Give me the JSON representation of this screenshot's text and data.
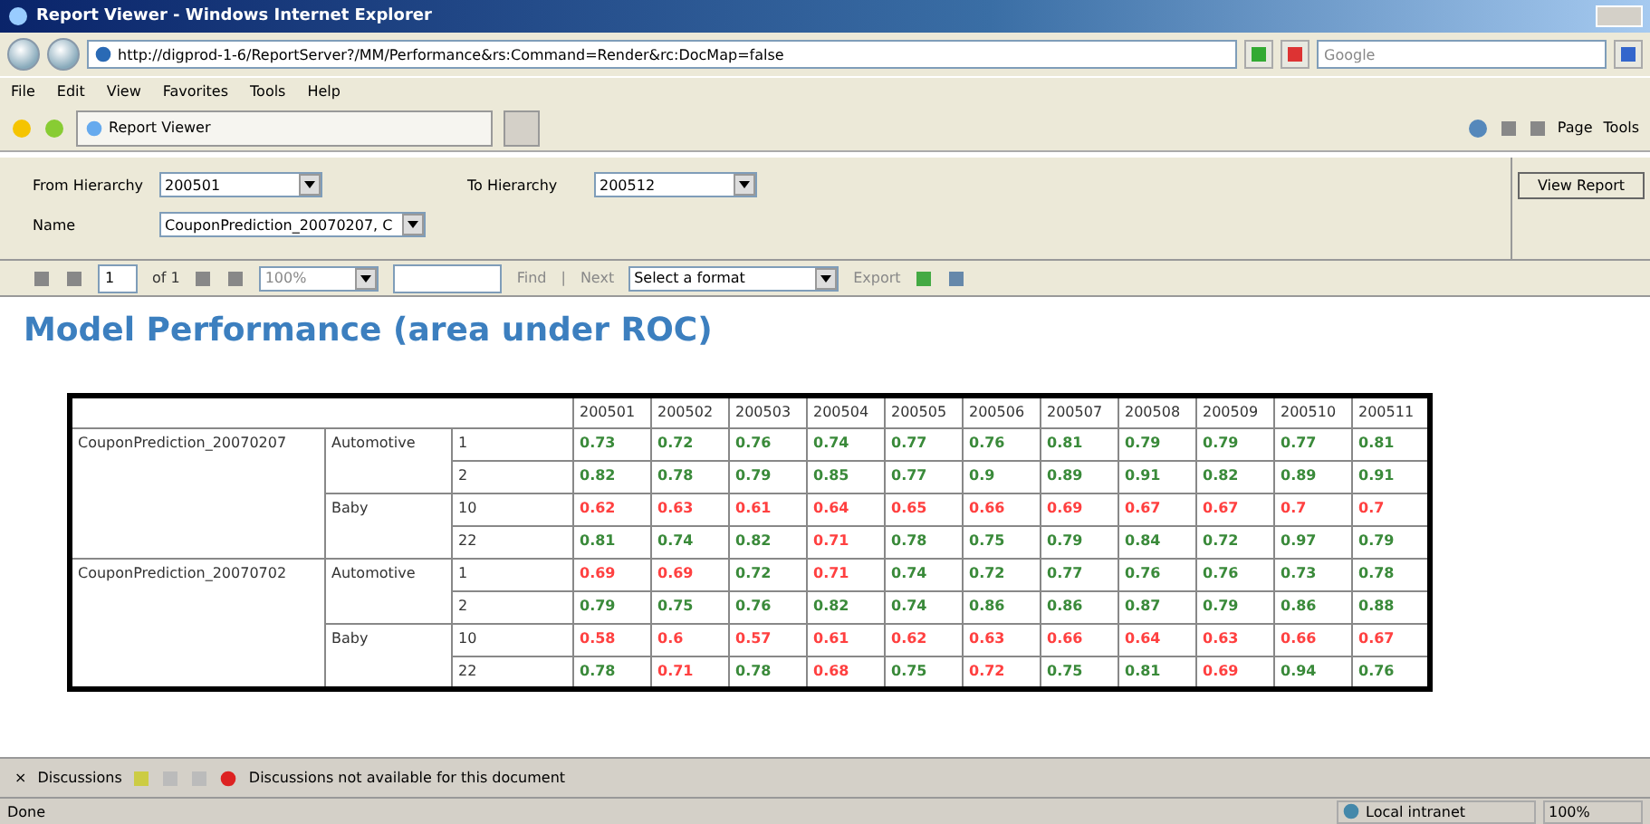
{
  "window": {
    "title": "Report Viewer - Windows Internet Explorer"
  },
  "address_bar": {
    "url": "http://digprod-1-6/ReportServer?/MM/Performance&rs:Command=Render&rc:DocMap=false",
    "search_placeholder": "Google"
  },
  "menu": [
    "File",
    "Edit",
    "View",
    "Favorites",
    "Tools",
    "Help"
  ],
  "tab": {
    "label": "Report Viewer"
  },
  "command_bar": [
    "Page",
    "Tools"
  ],
  "parameters": [
    {
      "label": "From Hierarchy",
      "value": "200501"
    },
    {
      "label": "To Hierarchy",
      "value": "200512"
    },
    {
      "label": "Name",
      "value": "CouponPrediction_20070207, C"
    }
  ],
  "view_report": "View Report",
  "report_toolbar": {
    "page": "1",
    "of": "of 1",
    "zoom": "100%",
    "find": "Find",
    "separator": "|",
    "next": "Next",
    "format": "Select a format",
    "export": "Export"
  },
  "report_title": "Model Performance (area under ROC)",
  "table": {
    "columns": [
      "200501",
      "200502",
      "200503",
      "200504",
      "200505",
      "200506",
      "200507",
      "200508",
      "200509",
      "200510",
      "200511"
    ],
    "groups": [
      {
        "name": "CouponPrediction_20070207",
        "categories": [
          {
            "name": "Automotive",
            "segments": [
              {
                "label": "1",
                "values": [
                  {
                    "text": "0.73",
                    "color": "#3a8a3a"
                  },
                  {
                    "text": "0.72",
                    "color": "#3a8a3a"
                  },
                  {
                    "text": "0.76",
                    "color": "#3a8a3a"
                  },
                  {
                    "text": "0.74",
                    "color": "#3a8a3a"
                  },
                  {
                    "text": "0.77",
                    "color": "#3a8a3a"
                  },
                  {
                    "text": "0.76",
                    "color": "#3a8a3a"
                  },
                  {
                    "text": "0.81",
                    "color": "#3a8a3a"
                  },
                  {
                    "text": "0.79",
                    "color": "#3a8a3a"
                  },
                  {
                    "text": "0.79",
                    "color": "#3a8a3a"
                  },
                  {
                    "text": "0.77",
                    "color": "#3a8a3a"
                  },
                  {
                    "text": "0.81",
                    "color": "#3a8a3a"
                  }
                ]
              },
              {
                "label": "2",
                "values": [
                  {
                    "text": "0.82",
                    "color": "#3a8a3a"
                  },
                  {
                    "text": "0.78",
                    "color": "#3a8a3a"
                  },
                  {
                    "text": "0.79",
                    "color": "#3a8a3a"
                  },
                  {
                    "text": "0.85",
                    "color": "#3a8a3a"
                  },
                  {
                    "text": "0.77",
                    "color": "#3a8a3a"
                  },
                  {
                    "text": "0.9",
                    "color": "#3a8a3a"
                  },
                  {
                    "text": "0.89",
                    "color": "#3a8a3a"
                  },
                  {
                    "text": "0.91",
                    "color": "#3a8a3a"
                  },
                  {
                    "text": "0.82",
                    "color": "#3a8a3a"
                  },
                  {
                    "text": "0.89",
                    "color": "#3a8a3a"
                  },
                  {
                    "text": "0.91",
                    "color": "#3a8a3a"
                  }
                ]
              }
            ]
          },
          {
            "name": "Baby",
            "segments": [
              {
                "label": "10",
                "values": [
                  {
                    "text": "0.62",
                    "color": "#ff4040"
                  },
                  {
                    "text": "0.63",
                    "color": "#ff4040"
                  },
                  {
                    "text": "0.61",
                    "color": "#ff4040"
                  },
                  {
                    "text": "0.64",
                    "color": "#ff4040"
                  },
                  {
                    "text": "0.65",
                    "color": "#ff4040"
                  },
                  {
                    "text": "0.66",
                    "color": "#ff4040"
                  },
                  {
                    "text": "0.69",
                    "color": "#ff4040"
                  },
                  {
                    "text": "0.67",
                    "color": "#ff4040"
                  },
                  {
                    "text": "0.67",
                    "color": "#ff4040"
                  },
                  {
                    "text": "0.7",
                    "color": "#ff4040"
                  },
                  {
                    "text": "0.7",
                    "color": "#ff4040"
                  }
                ]
              },
              {
                "label": "22",
                "values": [
                  {
                    "text": "0.81",
                    "color": "#3a8a3a"
                  },
                  {
                    "text": "0.74",
                    "color": "#3a8a3a"
                  },
                  {
                    "text": "0.82",
                    "color": "#3a8a3a"
                  },
                  {
                    "text": "0.71",
                    "color": "#ff4040"
                  },
                  {
                    "text": "0.78",
                    "color": "#3a8a3a"
                  },
                  {
                    "text": "0.75",
                    "color": "#3a8a3a"
                  },
                  {
                    "text": "0.79",
                    "color": "#3a8a3a"
                  },
                  {
                    "text": "0.84",
                    "color": "#3a8a3a"
                  },
                  {
                    "text": "0.72",
                    "color": "#3a8a3a"
                  },
                  {
                    "text": "0.97",
                    "color": "#3a8a3a"
                  },
                  {
                    "text": "0.79",
                    "color": "#3a8a3a"
                  }
                ]
              }
            ]
          }
        ]
      },
      {
        "name": "CouponPrediction_20070702",
        "categories": [
          {
            "name": "Automotive",
            "segments": [
              {
                "label": "1",
                "values": [
                  {
                    "text": "0.69",
                    "color": "#ff4040"
                  },
                  {
                    "text": "0.69",
                    "color": "#ff4040"
                  },
                  {
                    "text": "0.72",
                    "color": "#3a8a3a"
                  },
                  {
                    "text": "0.71",
                    "color": "#ff4040"
                  },
                  {
                    "text": "0.74",
                    "color": "#3a8a3a"
                  },
                  {
                    "text": "0.72",
                    "color": "#3a8a3a"
                  },
                  {
                    "text": "0.77",
                    "color": "#3a8a3a"
                  },
                  {
                    "text": "0.76",
                    "color": "#3a8a3a"
                  },
                  {
                    "text": "0.76",
                    "color": "#3a8a3a"
                  },
                  {
                    "text": "0.73",
                    "color": "#3a8a3a"
                  },
                  {
                    "text": "0.78",
                    "color": "#3a8a3a"
                  }
                ]
              },
              {
                "label": "2",
                "values": [
                  {
                    "text": "0.79",
                    "color": "#3a8a3a"
                  },
                  {
                    "text": "0.75",
                    "color": "#3a8a3a"
                  },
                  {
                    "text": "0.76",
                    "color": "#3a8a3a"
                  },
                  {
                    "text": "0.82",
                    "color": "#3a8a3a"
                  },
                  {
                    "text": "0.74",
                    "color": "#3a8a3a"
                  },
                  {
                    "text": "0.86",
                    "color": "#3a8a3a"
                  },
                  {
                    "text": "0.86",
                    "color": "#3a8a3a"
                  },
                  {
                    "text": "0.87",
                    "color": "#3a8a3a"
                  },
                  {
                    "text": "0.79",
                    "color": "#3a8a3a"
                  },
                  {
                    "text": "0.86",
                    "color": "#3a8a3a"
                  },
                  {
                    "text": "0.88",
                    "color": "#3a8a3a"
                  }
                ]
              }
            ]
          },
          {
            "name": "Baby",
            "segments": [
              {
                "label": "10",
                "values": [
                  {
                    "text": "0.58",
                    "color": "#ff4040"
                  },
                  {
                    "text": "0.6",
                    "color": "#ff4040"
                  },
                  {
                    "text": "0.57",
                    "color": "#ff4040"
                  },
                  {
                    "text": "0.61",
                    "color": "#ff4040"
                  },
                  {
                    "text": "0.62",
                    "color": "#ff4040"
                  },
                  {
                    "text": "0.63",
                    "color": "#ff4040"
                  },
                  {
                    "text": "0.66",
                    "color": "#ff4040"
                  },
                  {
                    "text": "0.64",
                    "color": "#ff4040"
                  },
                  {
                    "text": "0.63",
                    "color": "#ff4040"
                  },
                  {
                    "text": "0.66",
                    "color": "#ff4040"
                  },
                  {
                    "text": "0.67",
                    "color": "#ff4040"
                  }
                ]
              },
              {
                "label": "22",
                "values": [
                  {
                    "text": "0.78",
                    "color": "#3a8a3a"
                  },
                  {
                    "text": "0.71",
                    "color": "#ff4040"
                  },
                  {
                    "text": "0.78",
                    "color": "#3a8a3a"
                  },
                  {
                    "text": "0.68",
                    "color": "#ff4040"
                  },
                  {
                    "text": "0.75",
                    "color": "#3a8a3a"
                  },
                  {
                    "text": "0.72",
                    "color": "#ff4040"
                  },
                  {
                    "text": "0.75",
                    "color": "#3a8a3a"
                  },
                  {
                    "text": "0.81",
                    "color": "#3a8a3a"
                  },
                  {
                    "text": "0.69",
                    "color": "#ff4040"
                  },
                  {
                    "text": "0.94",
                    "color": "#3a8a3a"
                  },
                  {
                    "text": "0.76",
                    "color": "#3a8a3a"
                  }
                ]
              }
            ]
          }
        ]
      }
    ]
  },
  "discussions_bar": {
    "close": "×",
    "menu": "Discussions",
    "message": "Discussions not available for this document"
  },
  "status_bar": {
    "text": "Done",
    "zone": "Local intranet",
    "zoom": "100%"
  }
}
